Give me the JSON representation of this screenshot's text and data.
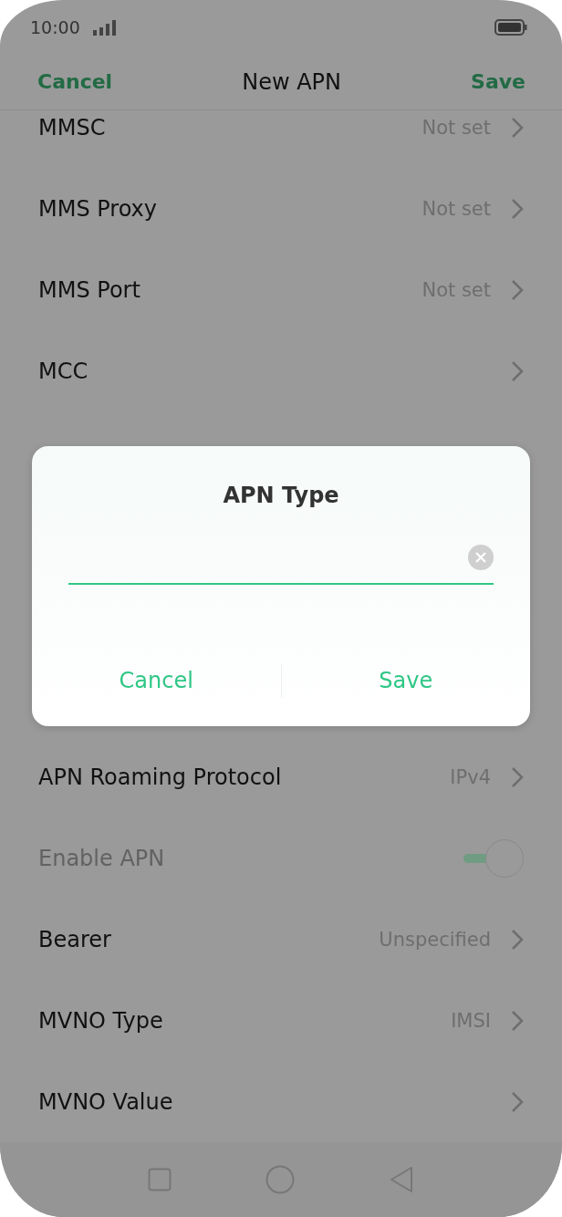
{
  "status_bar": {
    "time": "10:00"
  },
  "header": {
    "cancel": "Cancel",
    "title": "New APN",
    "save": "Save"
  },
  "rows_above": [
    {
      "kind": "nav",
      "label": "MMSC",
      "value": "Not set"
    },
    {
      "kind": "nav",
      "label": "MMS Proxy",
      "value": "Not set"
    },
    {
      "kind": "nav",
      "label": "MMS Port",
      "value": "Not set"
    },
    {
      "kind": "nav",
      "label": "MCC"
    }
  ],
  "rows_below": [
    {
      "kind": "nav",
      "label": "APN Roaming Protocol",
      "value": "IPv4"
    },
    {
      "kind": "toggle",
      "label": "Enable APN",
      "on": true,
      "disabled": true
    },
    {
      "kind": "nav",
      "label": "Bearer",
      "value": "Unspecified"
    },
    {
      "kind": "nav",
      "label": "MVNO Type",
      "value": "IMSI"
    },
    {
      "kind": "nav",
      "label": "MVNO Value"
    }
  ],
  "dialog": {
    "title": "APN Type",
    "cancel": "Cancel",
    "save": "Save"
  }
}
